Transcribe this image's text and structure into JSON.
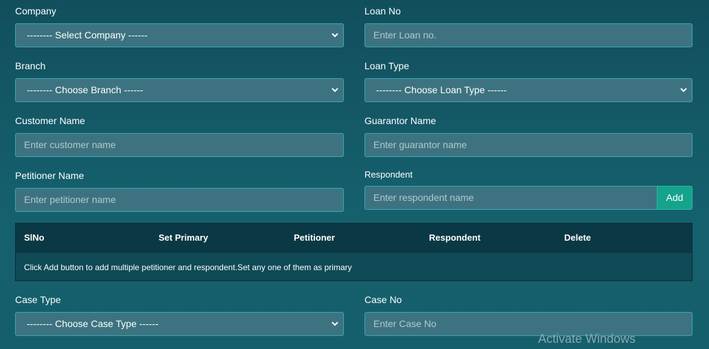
{
  "form": {
    "company": {
      "label": "Company",
      "selected": "-------- Select Company ------"
    },
    "loan_no": {
      "label": "Loan No",
      "placeholder": "Enter Loan no."
    },
    "branch": {
      "label": "Branch",
      "selected": "-------- Choose Branch ------"
    },
    "loan_type": {
      "label": "Loan Type",
      "selected": "-------- Choose Loan Type ------"
    },
    "customer_name": {
      "label": "Customer Name",
      "placeholder": "Enter customer name"
    },
    "guarantor_name": {
      "label": "Guarantor Name",
      "placeholder": "Enter guarantor name"
    },
    "petitioner_name": {
      "label": "Petitioner Name",
      "placeholder": "Enter petitioner name"
    },
    "respondent": {
      "label": "Respondent",
      "placeholder": "Enter respondent name",
      "add_label": "Add"
    },
    "case_type": {
      "label": "Case Type",
      "selected": "-------- Choose Case Type ------"
    },
    "case_no": {
      "label": "Case No",
      "placeholder": "Enter Case No"
    }
  },
  "table": {
    "columns": [
      "SlNo",
      "Set Primary",
      "Petitioner",
      "Respondent",
      "Delete"
    ],
    "empty_message": "Click Add button to add multiple petitioner and respondent.Set any one of them as primary"
  },
  "watermark": "Activate Windows",
  "colors": {
    "background": "#124f5d",
    "field": "#3d7380",
    "field_border": "#3aa6b4",
    "table_header": "#0b3845",
    "add_button": "#15a38d"
  }
}
